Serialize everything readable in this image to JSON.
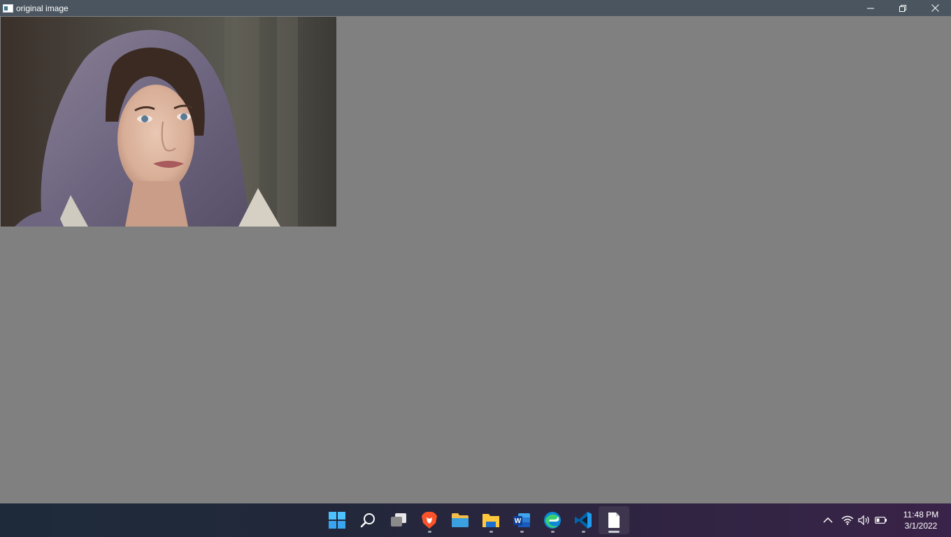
{
  "window": {
    "title": "original image",
    "icon": "app-window-icon",
    "controls": {
      "minimize": "minimize-icon",
      "maximize": "restore-icon",
      "close": "close-icon"
    },
    "background_color": "#808080",
    "titlebar_color": "#4a5560"
  },
  "image": {
    "subject": "photo"
  },
  "taskbar": {
    "apps": [
      {
        "name": "start",
        "icon": "windows-start-icon",
        "running": false
      },
      {
        "name": "search",
        "icon": "search-icon",
        "running": false
      },
      {
        "name": "task-view",
        "icon": "task-view-icon",
        "running": false
      },
      {
        "name": "brave",
        "icon": "brave-browser-icon",
        "running": true
      },
      {
        "name": "file-explorer",
        "icon": "folder-icon",
        "running": false
      },
      {
        "name": "file-manager",
        "icon": "file-explorer-icon",
        "running": true
      },
      {
        "name": "word",
        "icon": "word-icon",
        "running": true
      },
      {
        "name": "edge",
        "icon": "edge-browser-icon",
        "running": true
      },
      {
        "name": "vscode",
        "icon": "vscode-icon",
        "running": true
      },
      {
        "name": "document-window",
        "icon": "blank-document-icon",
        "running": true,
        "active": true
      }
    ],
    "tray": {
      "icons": [
        "chevron-up-icon",
        "wifi-icon",
        "volume-icon",
        "battery-icon"
      ]
    },
    "clock": {
      "time": "11:48 PM",
      "date": "3/1/2022"
    }
  }
}
